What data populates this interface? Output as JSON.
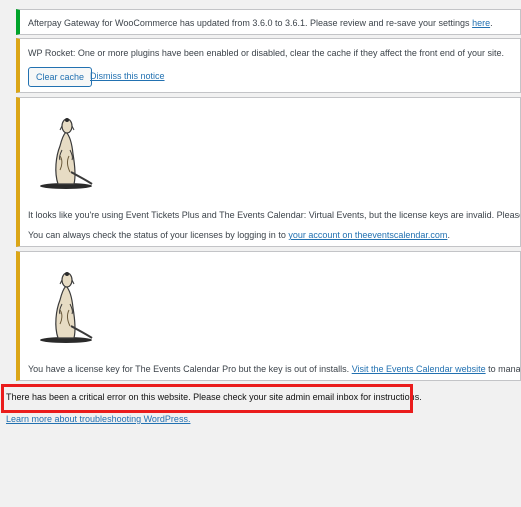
{
  "afterpay_notice": {
    "text": "Afterpay Gateway for WooCommerce has updated from 3.6.0 to 3.6.1. Please review and re-save your settings",
    "link": "here",
    "suffix": "."
  },
  "wprocket_notice": {
    "label": "WP Rocket:",
    "text": " One or more plugins have been enabled or disabled, clear the cache if they affect the front end of your site.",
    "clear_cache_button": "Clear cache",
    "dismiss_link": "Dismiss this notice"
  },
  "event_tickets_notice": {
    "text": "It looks like you're using Event Tickets Plus and The Events Calendar: Virtual Events, but the license keys are invalid. Please downlo",
    "status_prefix": "You can always check the status of your licenses by logging in to ",
    "account_link": "your account on theeventscalendar.com",
    "status_suffix": "."
  },
  "events_pro_notice": {
    "prefix": "You have a license key for The Events Calendar Pro but the key is out of installs. ",
    "link": "Visit the Events Calendar website",
    "suffix": " to manage your"
  },
  "critical_error": {
    "message": "There has been a critical error on this website. Please check your site admin email inbox for instructions.",
    "learn_more_link": "Learn more about troubleshooting WordPress."
  },
  "colors": {
    "success_border": "#00a32a",
    "warning_border": "#dba617",
    "link": "#2271b1",
    "highlight_box": "#ea1c1c"
  },
  "icons": {
    "mascot": "meerkat-icon"
  }
}
